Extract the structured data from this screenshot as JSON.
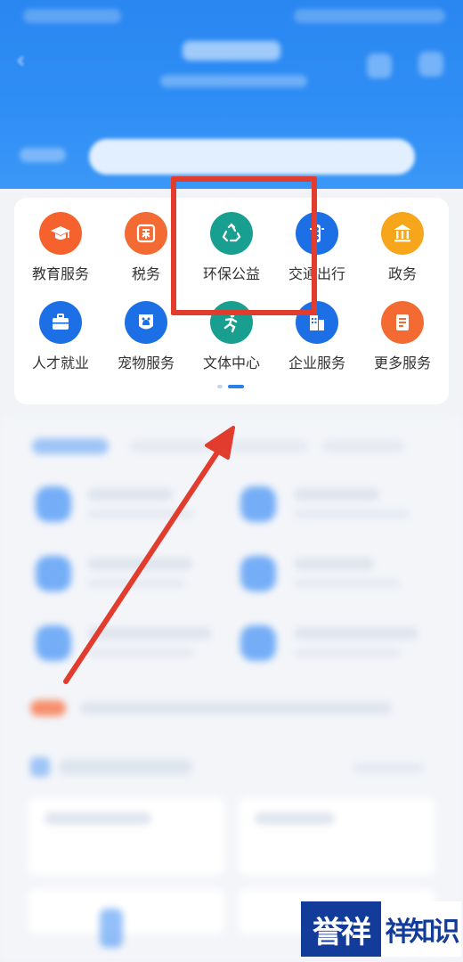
{
  "services": [
    {
      "label": "教育服务",
      "icon": "graduation-cap-icon",
      "color": "#f5622d"
    },
    {
      "label": "税务",
      "icon": "tax-stamp-icon",
      "color": "#f36a32"
    },
    {
      "label": "环保公益",
      "icon": "recycle-icon",
      "color": "#199f8f"
    },
    {
      "label": "交通出行",
      "icon": "traffic-light-icon",
      "color": "#1d6fe6"
    },
    {
      "label": "政务",
      "icon": "government-building-icon",
      "color": "#f7a51a"
    },
    {
      "label": "人才就业",
      "icon": "briefcase-icon",
      "color": "#1d6fe6"
    },
    {
      "label": "宠物服务",
      "icon": "pet-icon",
      "color": "#1d6fe6"
    },
    {
      "label": "文体中心",
      "icon": "sports-icon",
      "color": "#199f8f"
    },
    {
      "label": "企业服务",
      "icon": "office-building-icon",
      "color": "#1d6fe6"
    },
    {
      "label": "更多服务",
      "icon": "more-box-icon",
      "color": "#f36a32"
    }
  ],
  "annotation": {
    "color": "#e23c2f"
  },
  "watermark": {
    "left": "誉祥",
    "right": "祥知识"
  }
}
